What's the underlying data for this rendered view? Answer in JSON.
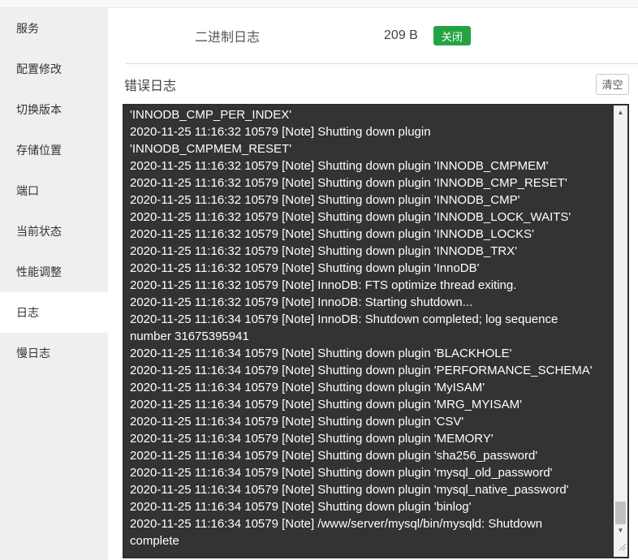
{
  "sidebar": {
    "items": [
      {
        "label": "服务",
        "active": false
      },
      {
        "label": "配置修改",
        "active": false
      },
      {
        "label": "切换版本",
        "active": false
      },
      {
        "label": "存储位置",
        "active": false
      },
      {
        "label": "端口",
        "active": false
      },
      {
        "label": "当前状态",
        "active": false
      },
      {
        "label": "性能调整",
        "active": false
      },
      {
        "label": "日志",
        "active": true
      },
      {
        "label": "慢日志",
        "active": false
      }
    ]
  },
  "binlog_header": {
    "title": "二进制日志",
    "size": "209 B",
    "toggle_label": "关闭",
    "toggle_color": "#25a342"
  },
  "error_log": {
    "title": "错误日志",
    "clear_label": "清空"
  },
  "log": {
    "background_color": "#333333",
    "text_color": "#ffffff",
    "lines": [
      "'INNODB_CMP_PER_INDEX'",
      "2020-11-25 11:16:32 10579 [Note] Shutting down plugin",
      "'INNODB_CMPMEM_RESET'",
      "2020-11-25 11:16:32 10579 [Note] Shutting down plugin 'INNODB_CMPMEM'",
      "2020-11-25 11:16:32 10579 [Note] Shutting down plugin 'INNODB_CMP_RESET'",
      "2020-11-25 11:16:32 10579 [Note] Shutting down plugin 'INNODB_CMP'",
      "2020-11-25 11:16:32 10579 [Note] Shutting down plugin 'INNODB_LOCK_WAITS'",
      "2020-11-25 11:16:32 10579 [Note] Shutting down plugin 'INNODB_LOCKS'",
      "2020-11-25 11:16:32 10579 [Note] Shutting down plugin 'INNODB_TRX'",
      "2020-11-25 11:16:32 10579 [Note] Shutting down plugin 'InnoDB'",
      "2020-11-25 11:16:32 10579 [Note] InnoDB: FTS optimize thread exiting.",
      "2020-11-25 11:16:32 10579 [Note] InnoDB: Starting shutdown...",
      "2020-11-25 11:16:34 10579 [Note] InnoDB: Shutdown completed; log sequence",
      "number 31675395941",
      "2020-11-25 11:16:34 10579 [Note] Shutting down plugin 'BLACKHOLE'",
      "2020-11-25 11:16:34 10579 [Note] Shutting down plugin 'PERFORMANCE_SCHEMA'",
      "2020-11-25 11:16:34 10579 [Note] Shutting down plugin 'MyISAM'",
      "2020-11-25 11:16:34 10579 [Note] Shutting down plugin 'MRG_MYISAM'",
      "2020-11-25 11:16:34 10579 [Note] Shutting down plugin 'CSV'",
      "2020-11-25 11:16:34 10579 [Note] Shutting down plugin 'MEMORY'",
      "2020-11-25 11:16:34 10579 [Note] Shutting down plugin 'sha256_password'",
      "2020-11-25 11:16:34 10579 [Note] Shutting down plugin 'mysql_old_password'",
      "2020-11-25 11:16:34 10579 [Note] Shutting down plugin 'mysql_native_password'",
      "2020-11-25 11:16:34 10579 [Note] Shutting down plugin 'binlog'",
      "2020-11-25 11:16:34 10579 [Note] /www/server/mysql/bin/mysqld: Shutdown",
      "complete"
    ]
  },
  "scrollbar": {
    "up_glyph": "▲",
    "down_glyph": "▼",
    "thumb_color": "#c1c1c1"
  }
}
